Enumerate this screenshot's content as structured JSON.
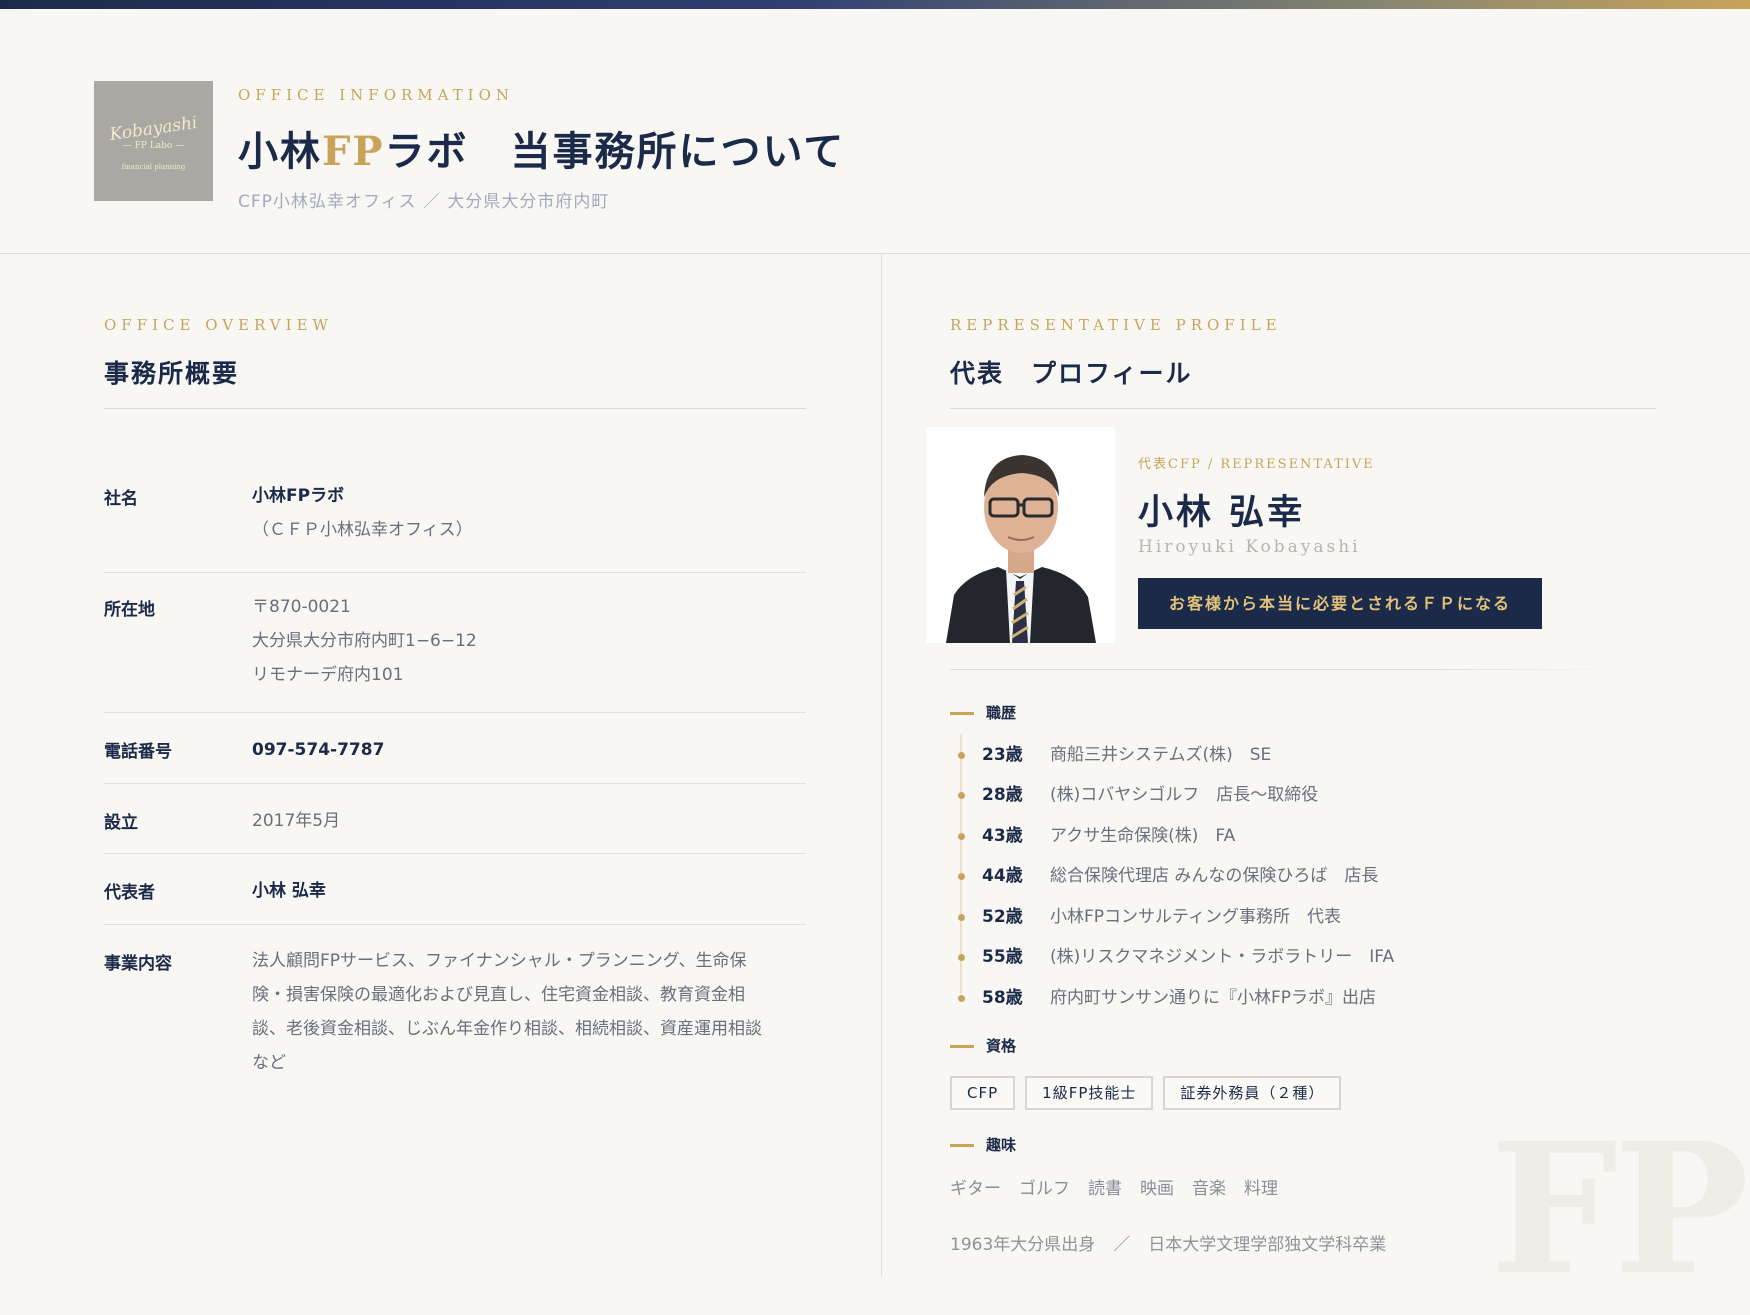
{
  "header": {
    "logo_line1": "Kobayashi",
    "logo_line2": "— FP Labo —",
    "logo_line3": "financial planning",
    "eyebrow": "OFFICE INFORMATION",
    "title_part1": "小林",
    "title_gold": "FP",
    "title_part2": "ラボ　当事務所について",
    "subtitle": "CFP小林弘幸オフィス ／ 大分県大分市府内町"
  },
  "overview": {
    "eyebrow": "OFFICE OVERVIEW",
    "title": "事務所概要",
    "rows": [
      {
        "label": "社名",
        "lines": [
          "小林FPラボ",
          "（ＣＦＰ小林弘幸オフィス）"
        ]
      },
      {
        "label": "所在地",
        "lines": [
          "〒870-0021",
          "大分県大分市府内町1−6−12",
          "リモナーデ府内101"
        ]
      },
      {
        "label": "電話番号",
        "lines": [
          "097-574-7787"
        ]
      },
      {
        "label": "設立",
        "lines": [
          "2017年5月"
        ]
      },
      {
        "label": "代表者",
        "lines": [
          "小林 弘幸"
        ]
      },
      {
        "label": "事業内容",
        "lines": [
          "法人顧問FPサービス、ファイナンシャル・プランニング、生命保",
          "険・損害保険の最適化および見直し、住宅資金相談、教育資金相",
          "談、老後資金相談、じぶん年金作り相談、相続相談、資産運用相談",
          "など"
        ]
      }
    ]
  },
  "profile": {
    "eyebrow": "REPRESENTATIVE PROFILE",
    "title": "代表　プロフィール",
    "role": "代表CFP / REPRESENTATIVE",
    "name": "小林 弘幸",
    "name_roman": "Hiroyuki Kobayashi",
    "motto": "お客様から本当に必要とされるＦＰになる",
    "career_title": "職歴",
    "career": [
      {
        "age": "23歳",
        "desc": "商船三井システムズ(株)　SE"
      },
      {
        "age": "28歳",
        "desc": "(株)コバヤシゴルフ　店長〜取締役"
      },
      {
        "age": "43歳",
        "desc": "アクサ生命保険(株)　FA"
      },
      {
        "age": "44歳",
        "desc": "総合保険代理店 みんなの保険ひろば　店長"
      },
      {
        "age": "52歳",
        "desc": "小林FPコンサルティング事務所　代表"
      },
      {
        "age": "55歳",
        "desc": "(株)リスクマネジメント・ラボラトリー　IFA"
      },
      {
        "age": "58歳",
        "desc": "府内町サンサン通りに『小林FPラボ』出店"
      }
    ],
    "qual_title": "資格",
    "quals": [
      "CFP",
      "1級FP技能士",
      "証券外務員（２種）"
    ],
    "hobby_title": "趣味",
    "hobbies": [
      "ギター",
      "ゴルフ",
      "読書",
      "映画",
      "音楽",
      "料理"
    ],
    "origin_birth": "1963年大分県出身",
    "origin_sep": "／",
    "origin_school": "日本大学文理学部独文学科卒業"
  },
  "watermark": "FP",
  "colors": {
    "navy": "#1c2a4a",
    "gold": "#c8a45a",
    "background": "#f8f7f3"
  },
  "icons": {
    "photo": "portrait-photo"
  }
}
